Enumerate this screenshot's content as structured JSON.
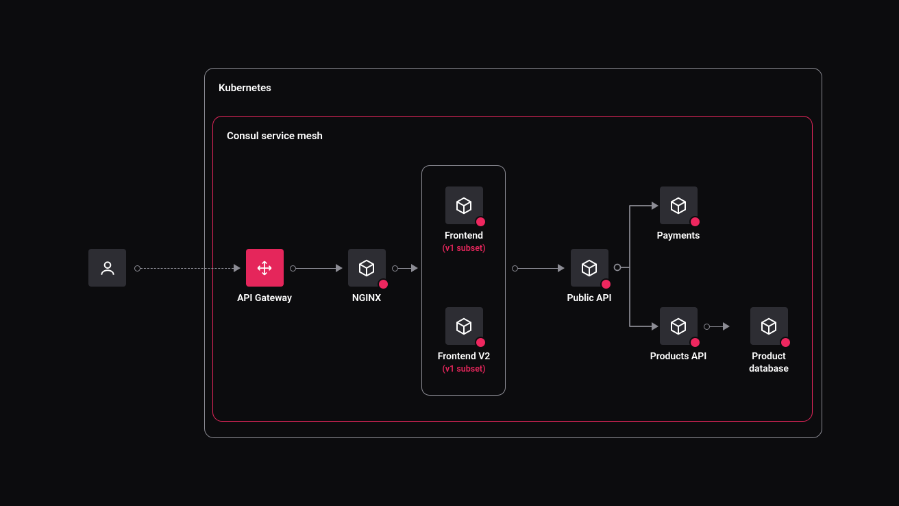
{
  "containers": {
    "kubernetes": "Kubernetes",
    "mesh": "Consul service mesh"
  },
  "nodes": {
    "user": "",
    "api_gateway": "API Gateway",
    "nginx": "NGINX",
    "frontend": {
      "label": "Frontend",
      "sub": "(v1 subset)"
    },
    "frontend_v2": {
      "label": "Frontend V2",
      "sub": "(v1 subset)"
    },
    "public_api": "Public API",
    "payments": "Payments",
    "products_api": "Products API",
    "product_db": "Product database"
  }
}
